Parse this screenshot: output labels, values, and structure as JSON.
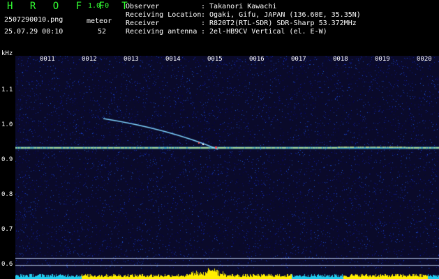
{
  "header": {
    "app_title": "H R O F F T",
    "app_version": "1.0.0",
    "filename": "2507290010.png",
    "datetime": "25.07.29 00:10",
    "detection_label": "meteor",
    "detection_count": "52"
  },
  "station": [
    {
      "label": "Observer",
      "value": ": Takanori Kawachi"
    },
    {
      "label": "Receiving Location",
      "value": ": Ogaki, Gifu, JAPAN (136.60E, 35.35N)"
    },
    {
      "label": "Receiver",
      "value": ": R820T2(RTL-SDR) SDR-Sharp 53.372MHz"
    },
    {
      "label": "Receiving antenna",
      "value": ": 2el-HB9CV Vertical (el. E-W)"
    }
  ],
  "spectrogram": {
    "y_unit": "kHz",
    "y_ticks": [
      "1.1",
      "1.0",
      "0.9",
      "0.8",
      "0.7",
      "0.6"
    ],
    "x_ticks": [
      "0011",
      "0012",
      "0013",
      "0014",
      "0015",
      "0016",
      "0017",
      "0018",
      "0019",
      "0020"
    ],
    "carrier_khz": 0.935,
    "colors": {
      "background": "#0a0a2a",
      "carrier": "#ffff66",
      "trail": "#7fd4ff",
      "meter": "#ffee00"
    }
  }
}
